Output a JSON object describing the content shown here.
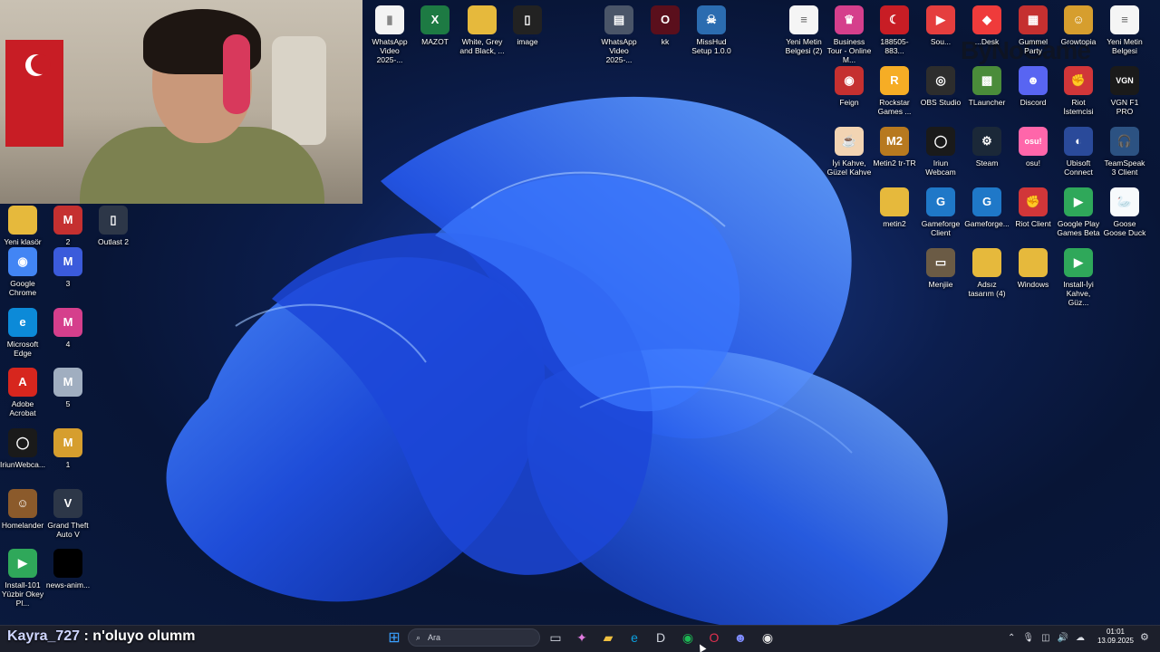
{
  "desktop": {
    "icons": [
      {
        "name": "icon-whatsapp-video-1",
        "label": "WhatsApp Video 2025-...",
        "glyph": "▮",
        "color": "#f3f3f3",
        "fg": "#888888"
      },
      {
        "name": "icon-mazot",
        "label": "MAZOT",
        "glyph": "X",
        "color": "#1d7a43"
      },
      {
        "name": "icon-white-grey-black",
        "label": "White, Grey and Black, ...",
        "glyph": "",
        "color": "#e6b93c"
      },
      {
        "name": "icon-image",
        "label": "image",
        "glyph": "▯",
        "color": "#222222"
      },
      {
        "name": "icon-whatsapp-video-2",
        "label": "WhatsApp Video 2025-...",
        "glyph": "▤",
        "color": "#4a5568"
      },
      {
        "name": "icon-kk",
        "label": "kk",
        "glyph": "O",
        "color": "#5a0f1c"
      },
      {
        "name": "icon-misshud",
        "label": "MissHud Setup 1.0.0",
        "glyph": "☠",
        "color": "#2b6cb0"
      },
      {
        "name": "icon-yeni-metin-2",
        "label": "Yeni Metin Belgesi (2)",
        "glyph": "≡",
        "color": "#f5f5f5",
        "fg": "#666666"
      },
      {
        "name": "icon-business-tour",
        "label": "Business Tour - Online M...",
        "glyph": "♛",
        "color": "#d53f8c"
      },
      {
        "name": "icon-flag-file",
        "label": "188505-883...",
        "glyph": "☾",
        "color": "#c81d25"
      },
      {
        "name": "icon-soundpad",
        "label": "Sou...",
        "glyph": "▶",
        "color": "#e53e3e"
      },
      {
        "name": "icon-anydesk",
        "label": "...Desk",
        "glyph": "◆",
        "color": "#ef3b3b"
      },
      {
        "name": "icon-gummel-party",
        "label": "Gummel Party",
        "glyph": "▦",
        "color": "#c53030"
      },
      {
        "name": "icon-growtopia",
        "label": "Growtopia",
        "glyph": "☺",
        "color": "#d69e2e"
      },
      {
        "name": "icon-yeni-metin",
        "label": "Yeni Metin Belgesi",
        "glyph": "≡",
        "color": "#f5f5f5",
        "fg": "#666666"
      },
      {
        "name": "icon-feign",
        "label": "Feign",
        "glyph": "◉",
        "color": "#c53030"
      },
      {
        "name": "icon-rockstar",
        "label": "Rockstar Games ...",
        "glyph": "R",
        "color": "#f6ad25"
      },
      {
        "name": "icon-obs",
        "label": "OBS Studio",
        "glyph": "◎",
        "color": "#2d2d2d"
      },
      {
        "name": "icon-tlauncher",
        "label": "TLauncher",
        "glyph": "▩",
        "color": "#4a8c3a"
      },
      {
        "name": "icon-discord",
        "label": "Discord",
        "glyph": "☻",
        "color": "#5865f2"
      },
      {
        "name": "icon-riot-istemcisi",
        "label": "Riot İstemcisi",
        "glyph": "✊",
        "color": "#d13639"
      },
      {
        "name": "icon-vgn-f1-pro",
        "label": "VGN F1 PRO",
        "glyph": "VGN",
        "color": "#1a1a1a"
      },
      {
        "name": "icon-iyi-kahve",
        "label": "İyi Kahve, Güzel Kahve",
        "glyph": "☕",
        "color": "#f2d4b3",
        "fg": "#7a4b2a"
      },
      {
        "name": "icon-metin2-tr",
        "label": "Metin2 tr-TR",
        "glyph": "M2",
        "color": "#b7791f"
      },
      {
        "name": "icon-iriun-webcam",
        "label": "Iriun Webcam",
        "glyph": "◯",
        "color": "#1a1a1a"
      },
      {
        "name": "icon-steam",
        "label": "Steam",
        "glyph": "⚙",
        "color": "#1b2838"
      },
      {
        "name": "icon-osu",
        "label": "osu!",
        "glyph": "osu!",
        "color": "#ff66aa"
      },
      {
        "name": "icon-ubisoft",
        "label": "Ubisoft Connect",
        "glyph": "◐",
        "color": "#2a4a9a"
      },
      {
        "name": "icon-teamspeak",
        "label": "TeamSpeak 3 Client",
        "glyph": "🎧",
        "color": "#2c5282"
      },
      {
        "name": "icon-metin2",
        "label": "metin2",
        "glyph": "",
        "color": "#e6b93c"
      },
      {
        "name": "icon-gameforge-client",
        "label": "Gameforge Client",
        "glyph": "G",
        "color": "#1f78c8"
      },
      {
        "name": "icon-gameforge-2",
        "label": "Gameforge...",
        "glyph": "G",
        "color": "#1f78c8"
      },
      {
        "name": "icon-riot-client",
        "label": "Riot Client",
        "glyph": "✊",
        "color": "#d13639"
      },
      {
        "name": "icon-google-play-games",
        "label": "Google Play Games Beta",
        "glyph": "▶",
        "color": "#2fa85a"
      },
      {
        "name": "icon-goose-goose-duck",
        "label": "Goose Goose Duck",
        "glyph": "🦢",
        "color": "#f7fafc",
        "fg": "#333333"
      },
      {
        "name": "icon-menjiie",
        "label": "Menjiie",
        "glyph": "▭",
        "color": "#6b5b45"
      },
      {
        "name": "icon-adsiz-tasarim",
        "label": "Adsız tasarım (4)",
        "glyph": "",
        "color": "#e6b93c"
      },
      {
        "name": "icon-windows-folder",
        "label": "Windows",
        "glyph": "",
        "color": "#e6b93c"
      },
      {
        "name": "icon-install-iyi-kahve",
        "label": "Install-İyi Kahve, Güz...",
        "glyph": "▶",
        "color": "#2fa85a"
      },
      {
        "name": "icon-yeni-klasor",
        "label": "Yeni klasör (2)",
        "glyph": "",
        "color": "#e6b93c"
      },
      {
        "name": "icon-2",
        "label": "2",
        "glyph": "M",
        "color": "#c53030"
      },
      {
        "name": "icon-outlast-2",
        "label": "Outlast 2",
        "glyph": "▯",
        "color": "#2d3748"
      },
      {
        "name": "icon-google-chrome",
        "label": "Google Chrome",
        "glyph": "◉",
        "color": "#4285f4"
      },
      {
        "name": "icon-3",
        "label": "3",
        "glyph": "M",
        "color": "#3b5bdb"
      },
      {
        "name": "icon-microsoft-edge",
        "label": "Microsoft Edge",
        "glyph": "e",
        "color": "#0c8ad8"
      },
      {
        "name": "icon-4",
        "label": "4",
        "glyph": "M",
        "color": "#d53f8c"
      },
      {
        "name": "icon-adobe-acrobat",
        "label": "Adobe Acrobat",
        "glyph": "A",
        "color": "#d7261e"
      },
      {
        "name": "icon-5",
        "label": "5",
        "glyph": "M",
        "color": "#a0aec0"
      },
      {
        "name": "icon-iriunwebcam",
        "label": "IriunWebca...",
        "glyph": "◯",
        "color": "#1a1a1a"
      },
      {
        "name": "icon-1",
        "label": "1",
        "glyph": "M",
        "color": "#d69e2e"
      },
      {
        "name": "icon-homelander",
        "label": "Homelander",
        "glyph": "☺",
        "color": "#8b5a2b"
      },
      {
        "name": "icon-gta-v",
        "label": "Grand Theft Auto V",
        "glyph": "V",
        "color": "#2d3748"
      },
      {
        "name": "icon-install-101-yuzbir",
        "label": "Install-101 Yüzbir Okey Pl...",
        "glyph": "▶",
        "color": "#2fa85a"
      },
      {
        "name": "icon-news-anim",
        "label": "news-anim...",
        "glyph": "",
        "color": "#000000"
      }
    ]
  },
  "watermark": "ByNoGame",
  "chat": {
    "user": "Kayra_727",
    "separator": " : ",
    "message": "n'oluyo olumm"
  },
  "taskbar": {
    "search_placeholder": "Ara",
    "apps": [
      {
        "name": "start-button",
        "glyph": "⊞",
        "color": "#3aa0ff"
      },
      {
        "name": "task-view-button",
        "glyph": "▭",
        "color": "#cfd3dc"
      },
      {
        "name": "copilot-button",
        "glyph": "✦",
        "color": "#e07be0"
      },
      {
        "name": "file-explorer-button",
        "glyph": "▰",
        "color": "#f0c040"
      },
      {
        "name": "edge-taskbar-button",
        "glyph": "e",
        "color": "#0ca0e0"
      },
      {
        "name": "dell-button",
        "glyph": "D",
        "color": "#cfd3dc"
      },
      {
        "name": "spotify-button",
        "glyph": "◉",
        "color": "#1db954"
      },
      {
        "name": "opera-button",
        "glyph": "O",
        "color": "#e0304f"
      },
      {
        "name": "discord-taskbar-button",
        "glyph": "☻",
        "color": "#7f8cff"
      },
      {
        "name": "chrome-taskbar-button",
        "glyph": "◉",
        "color": "#e8e8e8"
      }
    ]
  },
  "clock": {
    "time": "01:01",
    "date": "13.09.2025"
  }
}
